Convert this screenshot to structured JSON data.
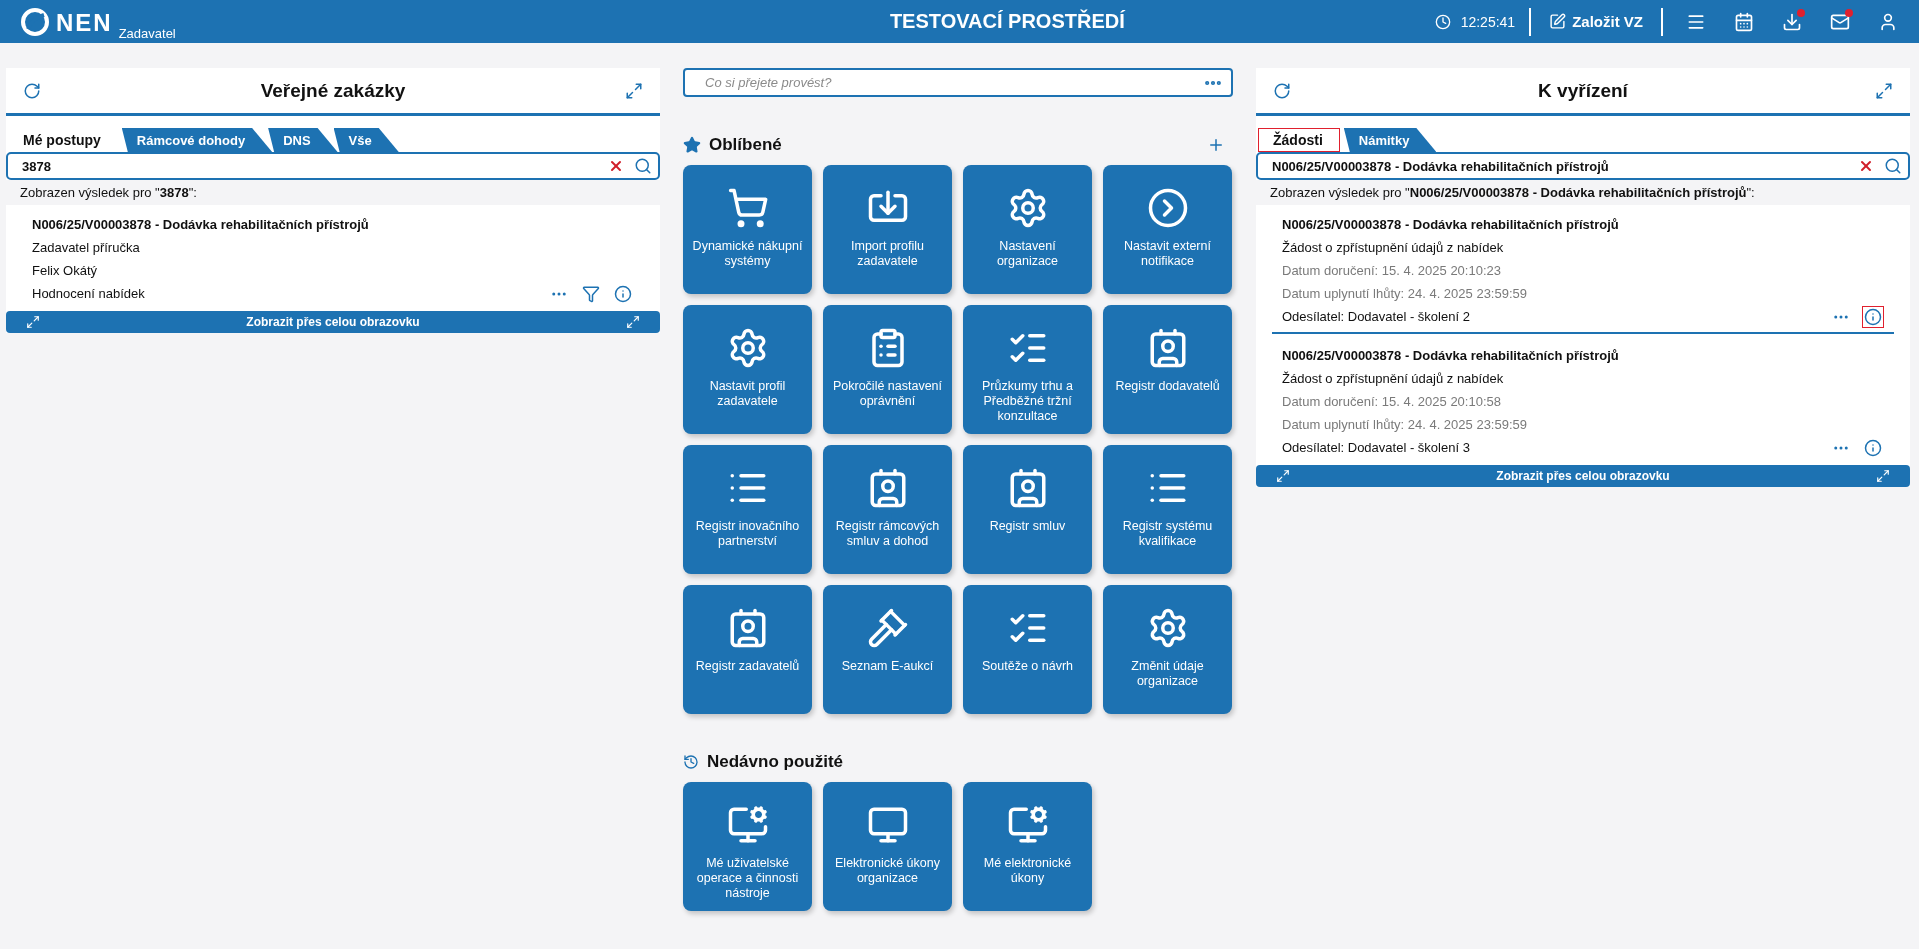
{
  "header": {
    "logo_text": "NEN",
    "logo_subtitle": "Zadavatel",
    "title": "TESTOVACÍ PROSTŘEDÍ",
    "time": "12:25:41",
    "create_label": "Založit VZ",
    "tools": [
      {
        "badge": false
      },
      {
        "badge": false
      },
      {
        "badge": true
      },
      {
        "badge": true
      },
      {
        "badge": false
      }
    ]
  },
  "left_panel": {
    "title": "Veřejné zakázky",
    "tabs": [
      {
        "label": "Mé postupy",
        "selected": true,
        "highlighted": false
      },
      {
        "label": "Rámcové dohody",
        "selected": false,
        "highlighted": false
      },
      {
        "label": "DNS",
        "selected": false,
        "highlighted": false
      },
      {
        "label": "Vše",
        "selected": false,
        "highlighted": false
      }
    ],
    "search": {
      "value": "3878"
    },
    "result_note": "Zobrazen výsledek pro \"**3878**\":",
    "items": [
      {
        "title": "N006/25/V00003878 - Dodávka rehabilitačních přístrojů",
        "lines": [
          {
            "text": "Zadavatel příručka",
            "muted": false
          },
          {
            "text": "Felix Okátý",
            "muted": false
          },
          {
            "text": "Hodnocení nabídek",
            "muted": false
          }
        ],
        "info_highlighted": false
      }
    ],
    "fullscreen_label": "Zobrazit přes celou obrazovku"
  },
  "middle": {
    "search": {
      "placeholder": "Co si přejete provést?"
    },
    "favorites": {
      "title": "Oblíbené",
      "tiles": [
        {
          "label": "Dynamické nákupní systémy"
        },
        {
          "label": "Import profilu zadavatele"
        },
        {
          "label": "Nastavení organizace"
        },
        {
          "label": "Nastavit externí notifikace"
        },
        {
          "label": "Nastavit profil zadavatele"
        },
        {
          "label": "Pokročilé nastavení oprávnění"
        },
        {
          "label": "Průzkumy trhu a Předběžné tržní konzultace"
        },
        {
          "label": "Registr dodavatelů"
        },
        {
          "label": "Registr inovačního partnerství"
        },
        {
          "label": "Registr rámcových smluv a dohod"
        },
        {
          "label": "Registr smluv"
        },
        {
          "label": "Registr systému kvalifikace"
        },
        {
          "label": "Registr zadavatelů"
        },
        {
          "label": "Seznam E-aukcí"
        },
        {
          "label": "Soutěže o návrh"
        },
        {
          "label": "Změnit údaje organizace"
        }
      ]
    },
    "recent": {
      "title": "Nedávno použité",
      "tiles": [
        {
          "label": "Mé uživatelské operace a činnosti nástroje"
        },
        {
          "label": "Elektronické úkony organizace"
        },
        {
          "label": "Mé elektronické úkony"
        }
      ]
    }
  },
  "right_panel": {
    "title": "K vyřízení",
    "tabs": [
      {
        "label": "Žádosti",
        "selected": true,
        "highlighted": true
      },
      {
        "label": "Námitky",
        "selected": false,
        "highlighted": false
      }
    ],
    "search": {
      "value": "N006/25/V00003878 - Dodávka rehabilitačních přístrojů"
    },
    "result_note": "Zobrazen výsledek pro \"**N006/25/V00003878 - Dodávka rehabilitačních přístrojů**\":",
    "items": [
      {
        "title": "N006/25/V00003878 - Dodávka rehabilitačních přístrojů",
        "lines": [
          {
            "text": "Žádost o zpřístupnění údajů z nabídek",
            "muted": false
          },
          {
            "text": "Datum doručení: 15. 4. 2025 20:10:23",
            "muted": true
          },
          {
            "text": "Datum uplynutí lhůty: 24. 4. 2025 23:59:59",
            "muted": true
          },
          {
            "text": "Odesílatel: Dodavatel - školení 2",
            "muted": false
          }
        ],
        "info_highlighted": true
      },
      {
        "title": "N006/25/V00003878 - Dodávka rehabilitačních přístrojů",
        "lines": [
          {
            "text": "Žádost o zpřístupnění údajů z nabídek",
            "muted": false
          },
          {
            "text": "Datum doručení: 15. 4. 2025 20:10:58",
            "muted": true
          },
          {
            "text": "Datum uplynutí lhůty: 24. 4. 2025 23:59:59",
            "muted": true
          },
          {
            "text": "Odesílatel: Dodavatel - školení 3",
            "muted": false
          }
        ],
        "info_highlighted": false
      }
    ],
    "fullscreen_label": "Zobrazit přes celou obrazovku"
  }
}
